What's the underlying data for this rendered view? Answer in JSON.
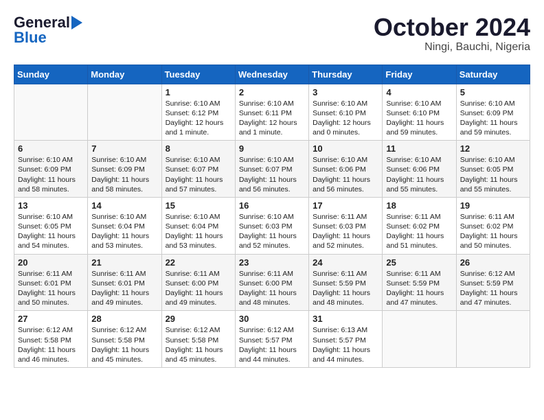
{
  "header": {
    "logo_line1": "General",
    "logo_line2": "Blue",
    "month": "October 2024",
    "location": "Ningi, Bauchi, Nigeria"
  },
  "weekdays": [
    "Sunday",
    "Monday",
    "Tuesday",
    "Wednesday",
    "Thursday",
    "Friday",
    "Saturday"
  ],
  "weeks": [
    [
      {
        "day": "",
        "content": ""
      },
      {
        "day": "",
        "content": ""
      },
      {
        "day": "1",
        "content": "Sunrise: 6:10 AM\nSunset: 6:12 PM\nDaylight: 12 hours\nand 1 minute."
      },
      {
        "day": "2",
        "content": "Sunrise: 6:10 AM\nSunset: 6:11 PM\nDaylight: 12 hours\nand 1 minute."
      },
      {
        "day": "3",
        "content": "Sunrise: 6:10 AM\nSunset: 6:10 PM\nDaylight: 12 hours\nand 0 minutes."
      },
      {
        "day": "4",
        "content": "Sunrise: 6:10 AM\nSunset: 6:10 PM\nDaylight: 11 hours\nand 59 minutes."
      },
      {
        "day": "5",
        "content": "Sunrise: 6:10 AM\nSunset: 6:09 PM\nDaylight: 11 hours\nand 59 minutes."
      }
    ],
    [
      {
        "day": "6",
        "content": "Sunrise: 6:10 AM\nSunset: 6:09 PM\nDaylight: 11 hours\nand 58 minutes."
      },
      {
        "day": "7",
        "content": "Sunrise: 6:10 AM\nSunset: 6:09 PM\nDaylight: 11 hours\nand 58 minutes."
      },
      {
        "day": "8",
        "content": "Sunrise: 6:10 AM\nSunset: 6:07 PM\nDaylight: 11 hours\nand 57 minutes."
      },
      {
        "day": "9",
        "content": "Sunrise: 6:10 AM\nSunset: 6:07 PM\nDaylight: 11 hours\nand 56 minutes."
      },
      {
        "day": "10",
        "content": "Sunrise: 6:10 AM\nSunset: 6:06 PM\nDaylight: 11 hours\nand 56 minutes."
      },
      {
        "day": "11",
        "content": "Sunrise: 6:10 AM\nSunset: 6:06 PM\nDaylight: 11 hours\nand 55 minutes."
      },
      {
        "day": "12",
        "content": "Sunrise: 6:10 AM\nSunset: 6:05 PM\nDaylight: 11 hours\nand 55 minutes."
      }
    ],
    [
      {
        "day": "13",
        "content": "Sunrise: 6:10 AM\nSunset: 6:05 PM\nDaylight: 11 hours\nand 54 minutes."
      },
      {
        "day": "14",
        "content": "Sunrise: 6:10 AM\nSunset: 6:04 PM\nDaylight: 11 hours\nand 53 minutes."
      },
      {
        "day": "15",
        "content": "Sunrise: 6:10 AM\nSunset: 6:04 PM\nDaylight: 11 hours\nand 53 minutes."
      },
      {
        "day": "16",
        "content": "Sunrise: 6:10 AM\nSunset: 6:03 PM\nDaylight: 11 hours\nand 52 minutes."
      },
      {
        "day": "17",
        "content": "Sunrise: 6:11 AM\nSunset: 6:03 PM\nDaylight: 11 hours\nand 52 minutes."
      },
      {
        "day": "18",
        "content": "Sunrise: 6:11 AM\nSunset: 6:02 PM\nDaylight: 11 hours\nand 51 minutes."
      },
      {
        "day": "19",
        "content": "Sunrise: 6:11 AM\nSunset: 6:02 PM\nDaylight: 11 hours\nand 50 minutes."
      }
    ],
    [
      {
        "day": "20",
        "content": "Sunrise: 6:11 AM\nSunset: 6:01 PM\nDaylight: 11 hours\nand 50 minutes."
      },
      {
        "day": "21",
        "content": "Sunrise: 6:11 AM\nSunset: 6:01 PM\nDaylight: 11 hours\nand 49 minutes."
      },
      {
        "day": "22",
        "content": "Sunrise: 6:11 AM\nSunset: 6:00 PM\nDaylight: 11 hours\nand 49 minutes."
      },
      {
        "day": "23",
        "content": "Sunrise: 6:11 AM\nSunset: 6:00 PM\nDaylight: 11 hours\nand 48 minutes."
      },
      {
        "day": "24",
        "content": "Sunrise: 6:11 AM\nSunset: 5:59 PM\nDaylight: 11 hours\nand 48 minutes."
      },
      {
        "day": "25",
        "content": "Sunrise: 6:11 AM\nSunset: 5:59 PM\nDaylight: 11 hours\nand 47 minutes."
      },
      {
        "day": "26",
        "content": "Sunrise: 6:12 AM\nSunset: 5:59 PM\nDaylight: 11 hours\nand 47 minutes."
      }
    ],
    [
      {
        "day": "27",
        "content": "Sunrise: 6:12 AM\nSunset: 5:58 PM\nDaylight: 11 hours\nand 46 minutes."
      },
      {
        "day": "28",
        "content": "Sunrise: 6:12 AM\nSunset: 5:58 PM\nDaylight: 11 hours\nand 45 minutes."
      },
      {
        "day": "29",
        "content": "Sunrise: 6:12 AM\nSunset: 5:58 PM\nDaylight: 11 hours\nand 45 minutes."
      },
      {
        "day": "30",
        "content": "Sunrise: 6:12 AM\nSunset: 5:57 PM\nDaylight: 11 hours\nand 44 minutes."
      },
      {
        "day": "31",
        "content": "Sunrise: 6:13 AM\nSunset: 5:57 PM\nDaylight: 11 hours\nand 44 minutes."
      },
      {
        "day": "",
        "content": ""
      },
      {
        "day": "",
        "content": ""
      }
    ]
  ]
}
